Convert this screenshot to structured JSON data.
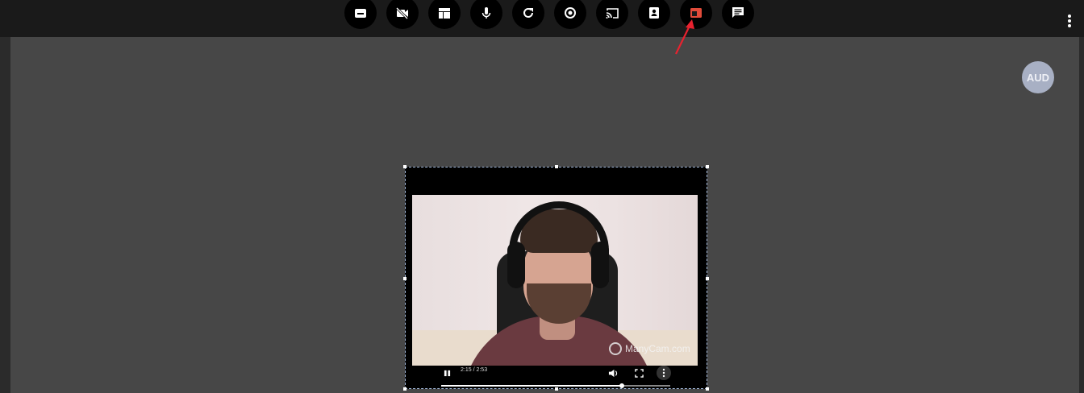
{
  "toolbar": {
    "buttons": [
      {
        "name": "leave-meeting-icon"
      },
      {
        "name": "video-off-icon"
      },
      {
        "name": "layout-icon"
      },
      {
        "name": "microphone-icon"
      },
      {
        "name": "refresh-icon"
      },
      {
        "name": "record-icon"
      },
      {
        "name": "cast-icon"
      },
      {
        "name": "participants-icon"
      },
      {
        "name": "picture-in-picture-icon",
        "color": "#e04b3a",
        "highlighted": true
      },
      {
        "name": "chat-icon"
      }
    ],
    "more_icon": "more-vert-icon"
  },
  "annotation": {
    "arrow_color": "#e8222f"
  },
  "participant": {
    "avatar_label": "AUD",
    "avatar_color": "#a8b0c4"
  },
  "video": {
    "watermark": "ManyCam.com",
    "time": "2:15 / 2:53",
    "progress": 0.79,
    "controls": [
      "pause-icon",
      "volume-icon",
      "fullscreen-icon",
      "more-vert-icon"
    ]
  }
}
